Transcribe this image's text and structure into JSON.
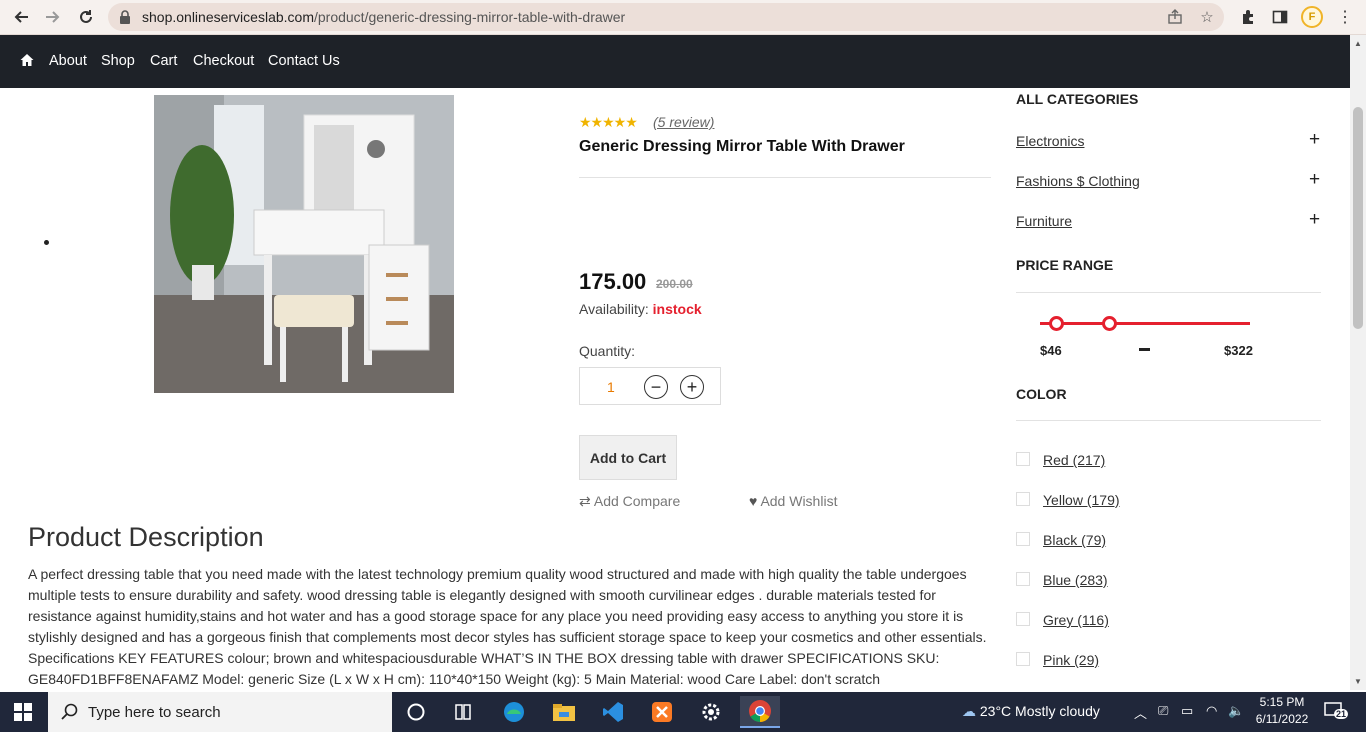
{
  "browser": {
    "url_host": "shop.onlineserviceslab.com",
    "url_path": "/product/generic-dressing-mirror-table-with-drawer",
    "profile_initial": "F"
  },
  "nav": {
    "items": [
      "About",
      "Shop",
      "Cart",
      "Checkout",
      "Contact Us"
    ]
  },
  "product": {
    "rating_stars": "★★★★★",
    "review_text": "(5 review)",
    "title": "Generic Dressing Mirror Table With Drawer",
    "price": "175.00",
    "old_price": "200.00",
    "availability_label": "Availability:",
    "availability_value": "instock",
    "quantity_label": "Quantity:",
    "quantity_value": "1",
    "add_to_cart": "Add to Cart",
    "add_compare": "Add Compare",
    "add_wishlist": "Add Wishlist"
  },
  "description": {
    "title": "Product Description",
    "text": "A perfect dressing table that you need made with the latest technology premium quality wood structured and made with high quality the table undergoes multiple tests to ensure durability and safety. wood dressing table is elegantly designed with smooth curvilinear edges . durable materials tested for resistance against humidity,stains and hot water and has a good storage space for any place you need providing easy access to anything you store it is stylishly designed and has a gorgeous finish that complements most decor styles has sufficient storage space to keep your cosmetics and other essentials. Specifications KEY FEATURES colour; brown and whitespaciousdurable WHAT’S IN THE BOX dressing table with drawer SPECIFICATIONS SKU: GE840FD1BFF8ENAFAMZ Model: generic Size (L x W x H cm): 110*40*150 Weight (kg): 5 Main Material: wood Care Label: don't scratch"
  },
  "sidebar": {
    "categories_title": "ALL CATEGORIES",
    "categories": [
      "Electronics",
      "Fashions $ Clothing",
      "Furniture"
    ],
    "price_title": "PRICE RANGE",
    "price_min": "$46",
    "price_max": "$322",
    "color_title": "COLOR",
    "colors": [
      "Red (217)",
      "Yellow (179)",
      "Black (79)",
      "Blue (283)",
      "Grey (116)",
      "Pink (29)"
    ]
  },
  "taskbar": {
    "search_placeholder": "Type here to search",
    "weather": "23°C  Mostly cloudy",
    "time": "5:15 PM",
    "date": "6/11/2022",
    "notification_count": "21"
  }
}
